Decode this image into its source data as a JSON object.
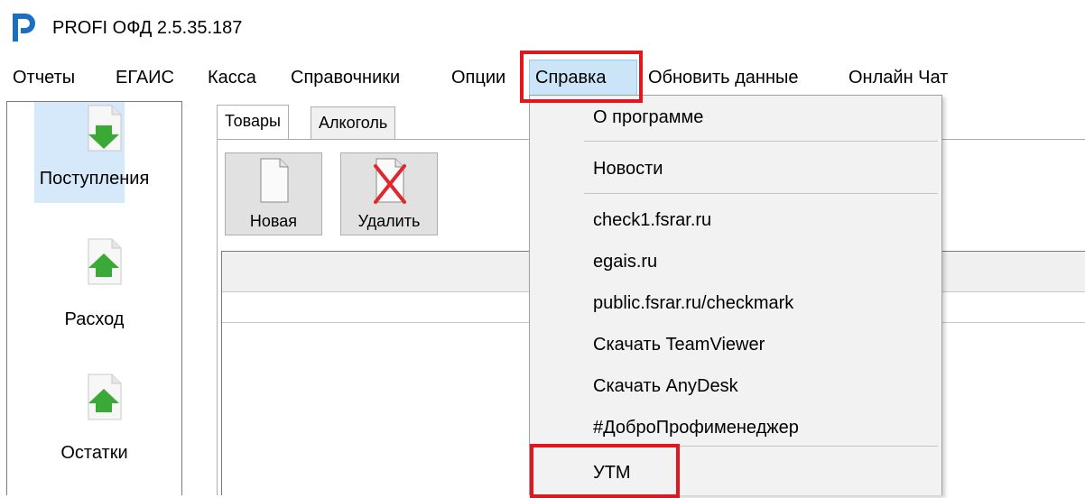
{
  "app": {
    "title": "PROFI ОФД 2.5.35.187",
    "logo_icon": "profi-p-logo",
    "logo_color": "#1b6fc2"
  },
  "menubar": {
    "items": [
      {
        "label": "Отчеты"
      },
      {
        "label": "ЕГАИС"
      },
      {
        "label": "Касса"
      },
      {
        "label": "Справочники"
      },
      {
        "label": "Опции"
      },
      {
        "label": "Справка",
        "active": true
      },
      {
        "label": "Обновить данные"
      },
      {
        "label": "Онлайн Чат"
      }
    ]
  },
  "highlight_color": "#e0171f",
  "sidebar": {
    "items": [
      {
        "label": "Поступления",
        "icon": "arrow-down-document-icon",
        "selected": true
      },
      {
        "label": "Расход",
        "icon": "arrow-up-document-icon"
      },
      {
        "label": "Остатки",
        "icon": "arrow-up-document-icon"
      }
    ]
  },
  "tabs": [
    {
      "label": "Товары",
      "active": true
    },
    {
      "label": "Алкоголь"
    }
  ],
  "toolbar": {
    "new_label": "Новая",
    "delete_label": "Удалить"
  },
  "dropdown": {
    "items": [
      {
        "label": "О программе"
      },
      {
        "label": "Новости"
      },
      {
        "label": "check1.fsrar.ru"
      },
      {
        "label": "egais.ru"
      },
      {
        "label": "public.fsrar.ru/checkmark"
      },
      {
        "label": "Скачать TeamViewer"
      },
      {
        "label": "Скачать AnyDesk"
      },
      {
        "label": "#ДоброПрофименеджер"
      },
      {
        "label": "УТМ"
      }
    ]
  }
}
